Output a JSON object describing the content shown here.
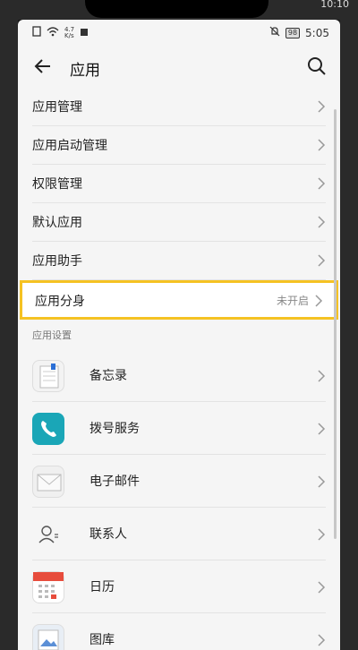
{
  "outer_status": {
    "time": "10:10"
  },
  "statusbar": {
    "speed": "4.7\nK/s",
    "battery": "98",
    "time": "5:05"
  },
  "appbar": {
    "title": "应用"
  },
  "menu": [
    {
      "label": "应用管理"
    },
    {
      "label": "应用启动管理"
    },
    {
      "label": "权限管理"
    },
    {
      "label": "默认应用"
    },
    {
      "label": "应用助手"
    }
  ],
  "highlight": {
    "label": "应用分身",
    "value": "未开启"
  },
  "section_title": "应用设置",
  "apps": [
    {
      "label": "备忘录",
      "icon": "notepad-icon"
    },
    {
      "label": "拨号服务",
      "icon": "phone-icon"
    },
    {
      "label": "电子邮件",
      "icon": "mail-icon"
    },
    {
      "label": "联系人",
      "icon": "contact-icon"
    },
    {
      "label": "日历",
      "icon": "calendar-icon"
    },
    {
      "label": "图库",
      "icon": "gallery-icon"
    }
  ],
  "colors": {
    "highlight_border": "#f5c223",
    "phone_icon": "#1aa6b7",
    "calendar_icon": "#e74c3c"
  }
}
